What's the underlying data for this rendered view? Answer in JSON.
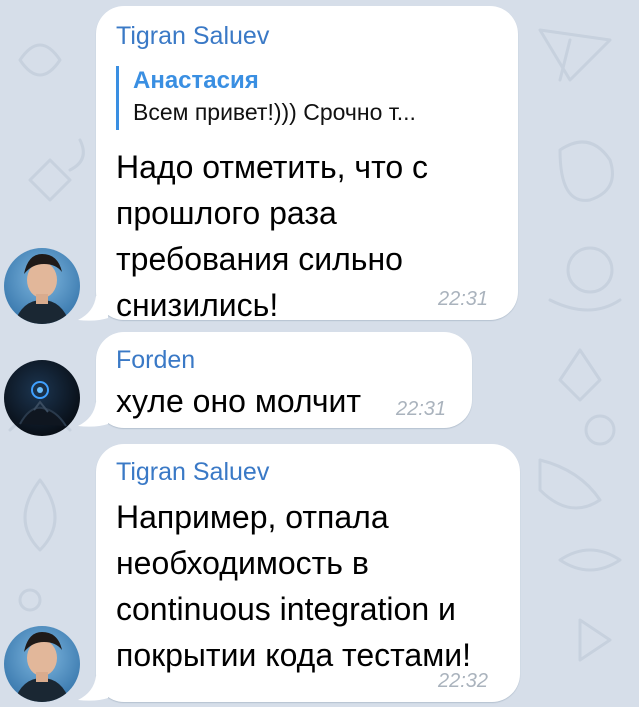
{
  "messages": [
    {
      "sender": "Tigran Saluev",
      "reply": {
        "name": "Анастасия",
        "text": "Всем привет!))) Срочно т..."
      },
      "lines": [
        "Надо отметить, что с",
        "прошлого раза",
        "требования сильно",
        "снизились!"
      ],
      "time": "22:31"
    },
    {
      "sender": "Forden",
      "lines": [
        "хуле оно молчит"
      ],
      "time": "22:31"
    },
    {
      "sender": "Tigran Saluev",
      "lines": [
        "Например, отпала",
        "необходимость в",
        "continuous integration и",
        "покрытии кода тестами!"
      ],
      "time": "22:32"
    }
  ],
  "colors": {
    "background": "#d6dee9",
    "bubble": "#ffffff",
    "sender_name": "#3a79c6",
    "reply_accent": "#3a8fe2",
    "timestamp": "#aab3bd"
  },
  "icons": [
    "avatar-tigran",
    "avatar-forden",
    "wallpaper-doodles"
  ]
}
